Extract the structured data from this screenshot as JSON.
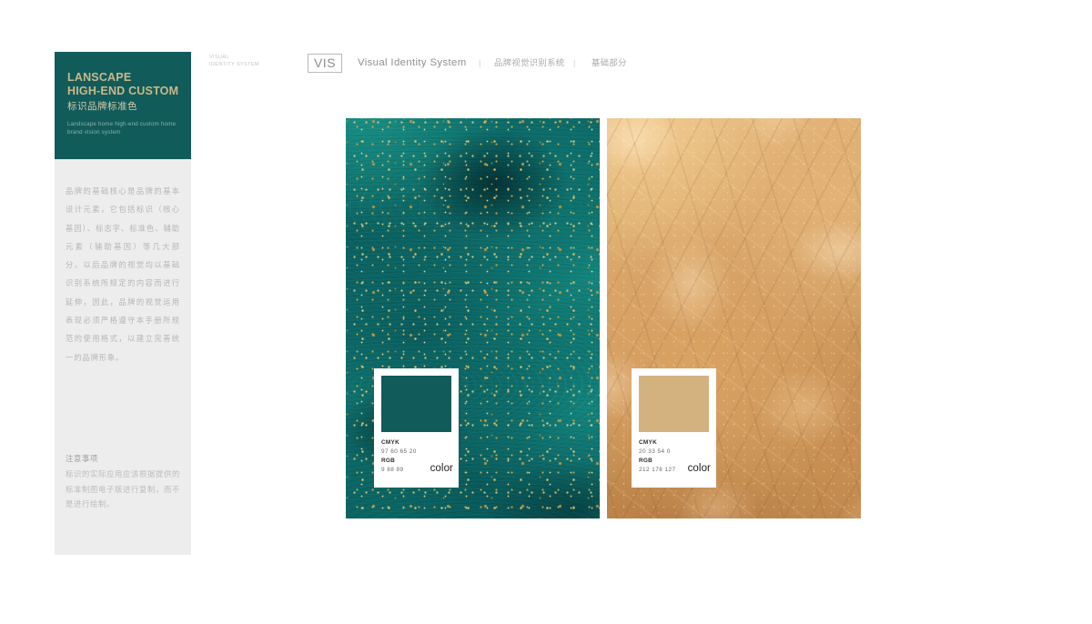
{
  "sidebar": {
    "brand_line_1": "LANSCAPE",
    "brand_line_2": "HIGH-END CUSTOM",
    "brand_cn": "标识品牌标准色",
    "brand_en": "Landscape home high-end custom home brand vision system",
    "paragraph": "品牌的基础核心是品牌的基本设计元素，它包括标识（核心基因）、标志字、标准色、辅助元素（辅助基因）等几大部分。以后品牌的视觉均以基础识别系统所规定的内容而进行延伸，因此，品牌的视觉运用表现必须严格遵守本手册所规范的使用格式，以建立完善统一的品牌形象。",
    "note_title": "注意事项",
    "note_body": "标识的实际应用应该根据提供的标准制图电子版进行复制，而不是进行绘制。"
  },
  "topnav": {
    "kicker_line_1": "VISUAL",
    "kicker_line_2": "IDENTITY SYSTEM",
    "badge": "VIS",
    "title": "Visual Identity System",
    "separator": "|",
    "link_1": "品牌视觉识别系统",
    "link_2": "基础部分"
  },
  "swatches": [
    {
      "name": "teal-swatch",
      "hex": "#115b5b",
      "cmyk_label": "CMYK",
      "cmyk_value": "97  60  65  20",
      "rgb_label": "RGB",
      "rgb_value": "9   88   89",
      "caption": "color"
    },
    {
      "name": "gold-swatch",
      "hex": "#d4b27f",
      "cmyk_label": "CMYK",
      "cmyk_value": "20  33  54  0",
      "rgb_label": "RGB",
      "rgb_value": "212  178  127",
      "caption": "color"
    }
  ],
  "images": [
    {
      "name": "teal-marble-image",
      "alt": "Teal green marble texture with gold flecks"
    },
    {
      "name": "gold-petals-image",
      "alt": "Golden flower petals with dew"
    }
  ],
  "colors": {
    "brand_teal": "#115b5b",
    "brand_gold": "#c9b98a",
    "swatch_gold": "#d4b27f",
    "panel_grey": "#ededed"
  }
}
